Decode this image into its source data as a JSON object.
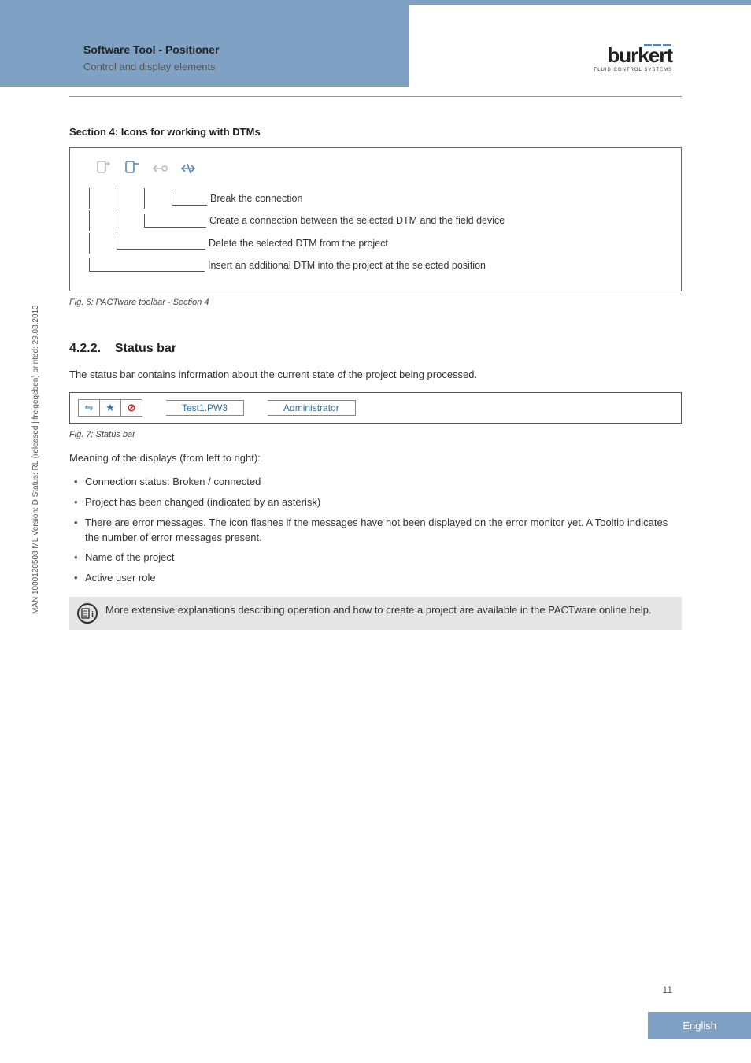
{
  "header": {
    "title": "Software Tool - Positioner",
    "subtitle": "Control and display elements",
    "logo_word": "burkert",
    "logo_sub": "FLUID CONTROL SYSTEMS"
  },
  "section4": {
    "title": "Section 4: Icons for working with DTMs",
    "callouts": [
      "Break the connection",
      "Create a connection between the selected DTM and the field device",
      "Delete the selected DTM from the project",
      "Insert an additional DTM into the project at the selected position"
    ],
    "caption": "Fig. 6:      PACTware toolbar - Section 4"
  },
  "section422": {
    "heading_no": "4.2.2.",
    "heading_text": "Status bar",
    "intro": "The status bar contains information about the current state of the project being processed.",
    "status_project": "Test1.PW3",
    "status_role": "Administrator",
    "caption": "Fig. 7:      Status bar",
    "meaning_intro": "Meaning of the displays (from left to right):",
    "bullets": [
      "Connection status: Broken / connected",
      "Project has been changed (indicated by an asterisk)",
      "There are error messages. The icon flashes if the messages have not been displayed on the error monitor yet. A Tooltip indicates the number of error messages present.",
      "Name of the project",
      "Active user role"
    ],
    "note": "More extensive explanations describing operation and how to create a project are available in the PACTware online help."
  },
  "sidetext": "MAN  1000120508  ML  Version: D  Status: RL (released | freigegeben)  printed: 29.08.2013",
  "page_number": "11",
  "language": "English"
}
